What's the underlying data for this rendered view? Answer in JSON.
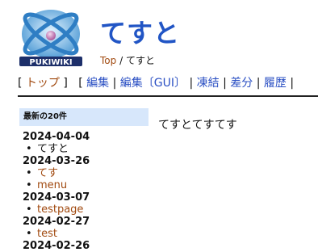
{
  "header": {
    "logo_text": "PUKIWIKI",
    "title": "てすと",
    "breadcrumb": {
      "root": "Top",
      "separator": "/",
      "current": "てすと"
    }
  },
  "navibar": {
    "open": "[",
    "close": "]",
    "items": [
      {
        "label": "トップ"
      },
      {
        "label": "編集"
      },
      {
        "label": "編集〔GUI〕"
      },
      {
        "label": "凍結"
      },
      {
        "label": "差分"
      },
      {
        "label": "履歴"
      }
    ],
    "separator": "|"
  },
  "menubar": {
    "heading": "最新の20件",
    "groups": [
      {
        "date": "2024-04-04",
        "entries": [
          {
            "label": "てすと",
            "current": true
          }
        ]
      },
      {
        "date": "2024-03-26",
        "entries": [
          {
            "label": "てす"
          },
          {
            "label": "menu"
          }
        ]
      },
      {
        "date": "2024-03-07",
        "entries": [
          {
            "label": "testpage"
          }
        ]
      },
      {
        "date": "2024-02-27",
        "entries": [
          {
            "label": "test"
          }
        ]
      },
      {
        "date": "2024-02-26",
        "entries": []
      }
    ]
  },
  "content": {
    "body": "てすとてすてす"
  },
  "colors": {
    "title": "#2155c5",
    "link": "#2a4fc3",
    "visited_link": "#a14a10",
    "menu_heading_bg": "#d7e7fb"
  }
}
